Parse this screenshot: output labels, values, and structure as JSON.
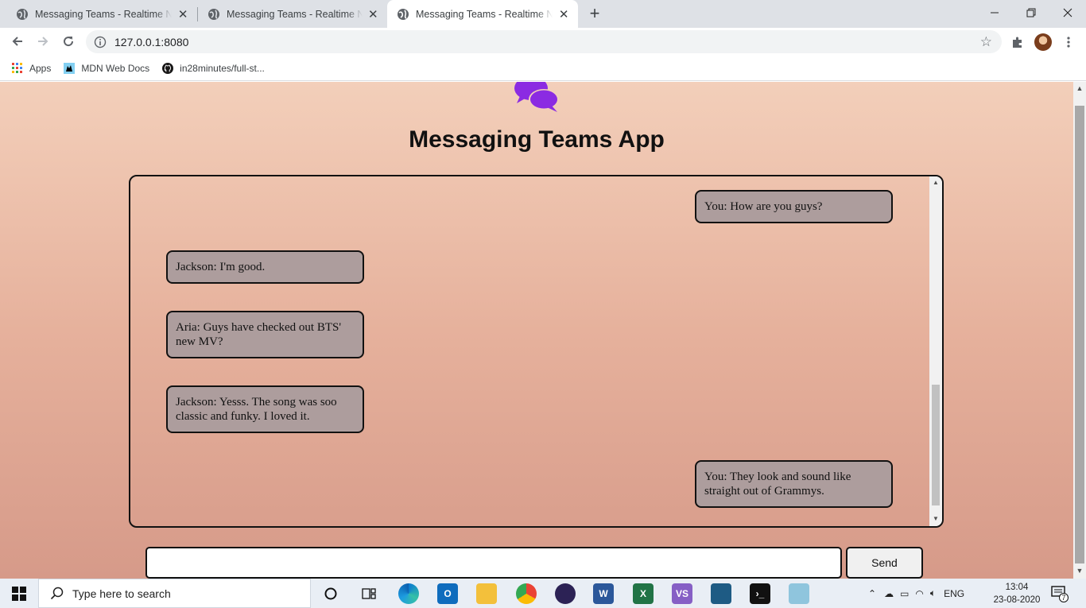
{
  "browser": {
    "tabs": [
      {
        "title": "Messaging Teams - Realtime Node"
      },
      {
        "title": "Messaging Teams - Realtime Node"
      },
      {
        "title": "Messaging Teams - Realtime Node"
      }
    ],
    "url": "127.0.0.1:8080",
    "bookmarks": [
      {
        "label": "Apps"
      },
      {
        "label": "MDN Web Docs"
      },
      {
        "label": "in28minutes/full-st..."
      }
    ]
  },
  "page": {
    "title": "Messaging Teams App",
    "logo_color": "#8b2be2",
    "messages": [
      {
        "side": "right",
        "text": "You: How are you guys?"
      },
      {
        "side": "left",
        "text": "Jackson: I'm good."
      },
      {
        "side": "left",
        "text": "Aria: Guys have checked out BTS' new MV?"
      },
      {
        "side": "left",
        "text": "Jackson: Yesss. The song was soo classic and funky. I loved it."
      },
      {
        "side": "right",
        "text": "You: They look and sound like straight out of Grammys."
      }
    ],
    "input_value": "",
    "send_label": "Send"
  },
  "taskbar": {
    "search_placeholder": "Type here to search",
    "language": "ENG",
    "time": "13:04",
    "date": "23-08-2020",
    "notification_count": "7"
  }
}
